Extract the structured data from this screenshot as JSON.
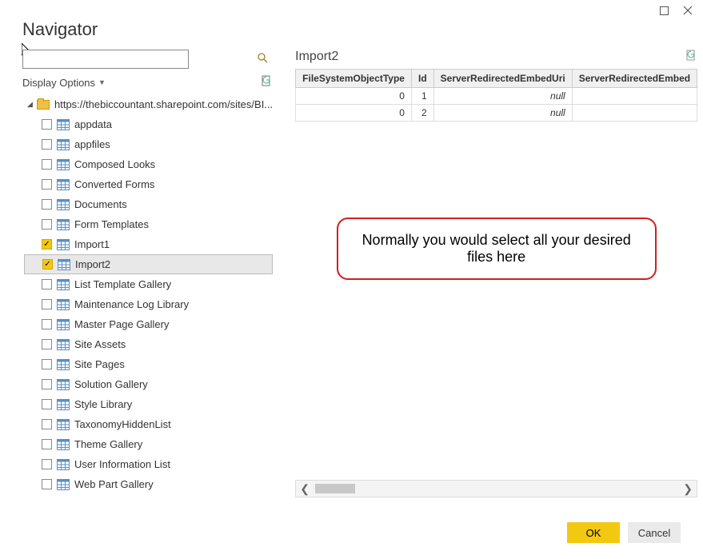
{
  "window": {
    "title": "Navigator",
    "maximize_icon": "maximize",
    "close_icon": "close"
  },
  "search": {
    "placeholder": ""
  },
  "display_options": {
    "label": "Display Options"
  },
  "tree": {
    "root": {
      "label": "https://thebiccountant.sharepoint.com/sites/BI...",
      "expanded": true
    },
    "items": [
      {
        "label": "appdata",
        "checked": false
      },
      {
        "label": "appfiles",
        "checked": false
      },
      {
        "label": "Composed Looks",
        "checked": false
      },
      {
        "label": "Converted Forms",
        "checked": false
      },
      {
        "label": "Documents",
        "checked": false
      },
      {
        "label": "Form Templates",
        "checked": false
      },
      {
        "label": "Import1",
        "checked": true
      },
      {
        "label": "Import2",
        "checked": true,
        "selected": true
      },
      {
        "label": "List Template Gallery",
        "checked": false
      },
      {
        "label": "Maintenance Log Library",
        "checked": false
      },
      {
        "label": "Master Page Gallery",
        "checked": false
      },
      {
        "label": "Site Assets",
        "checked": false
      },
      {
        "label": "Site Pages",
        "checked": false
      },
      {
        "label": "Solution Gallery",
        "checked": false
      },
      {
        "label": "Style Library",
        "checked": false
      },
      {
        "label": "TaxonomyHiddenList",
        "checked": false
      },
      {
        "label": "Theme Gallery",
        "checked": false
      },
      {
        "label": "User Information List",
        "checked": false
      },
      {
        "label": "Web Part Gallery",
        "checked": false
      }
    ]
  },
  "preview": {
    "title": "Import2",
    "columns": [
      "FileSystemObjectType",
      "Id",
      "ServerRedirectedEmbedUri",
      "ServerRedirectedEmbed"
    ],
    "rows": [
      {
        "FileSystemObjectType": "0",
        "Id": "1",
        "ServerRedirectedEmbedUri": "null"
      },
      {
        "FileSystemObjectType": "0",
        "Id": "2",
        "ServerRedirectedEmbedUri": "null"
      }
    ]
  },
  "annotation": {
    "text": "Normally you would select all your desired files here"
  },
  "buttons": {
    "ok": "OK",
    "cancel": "Cancel"
  }
}
